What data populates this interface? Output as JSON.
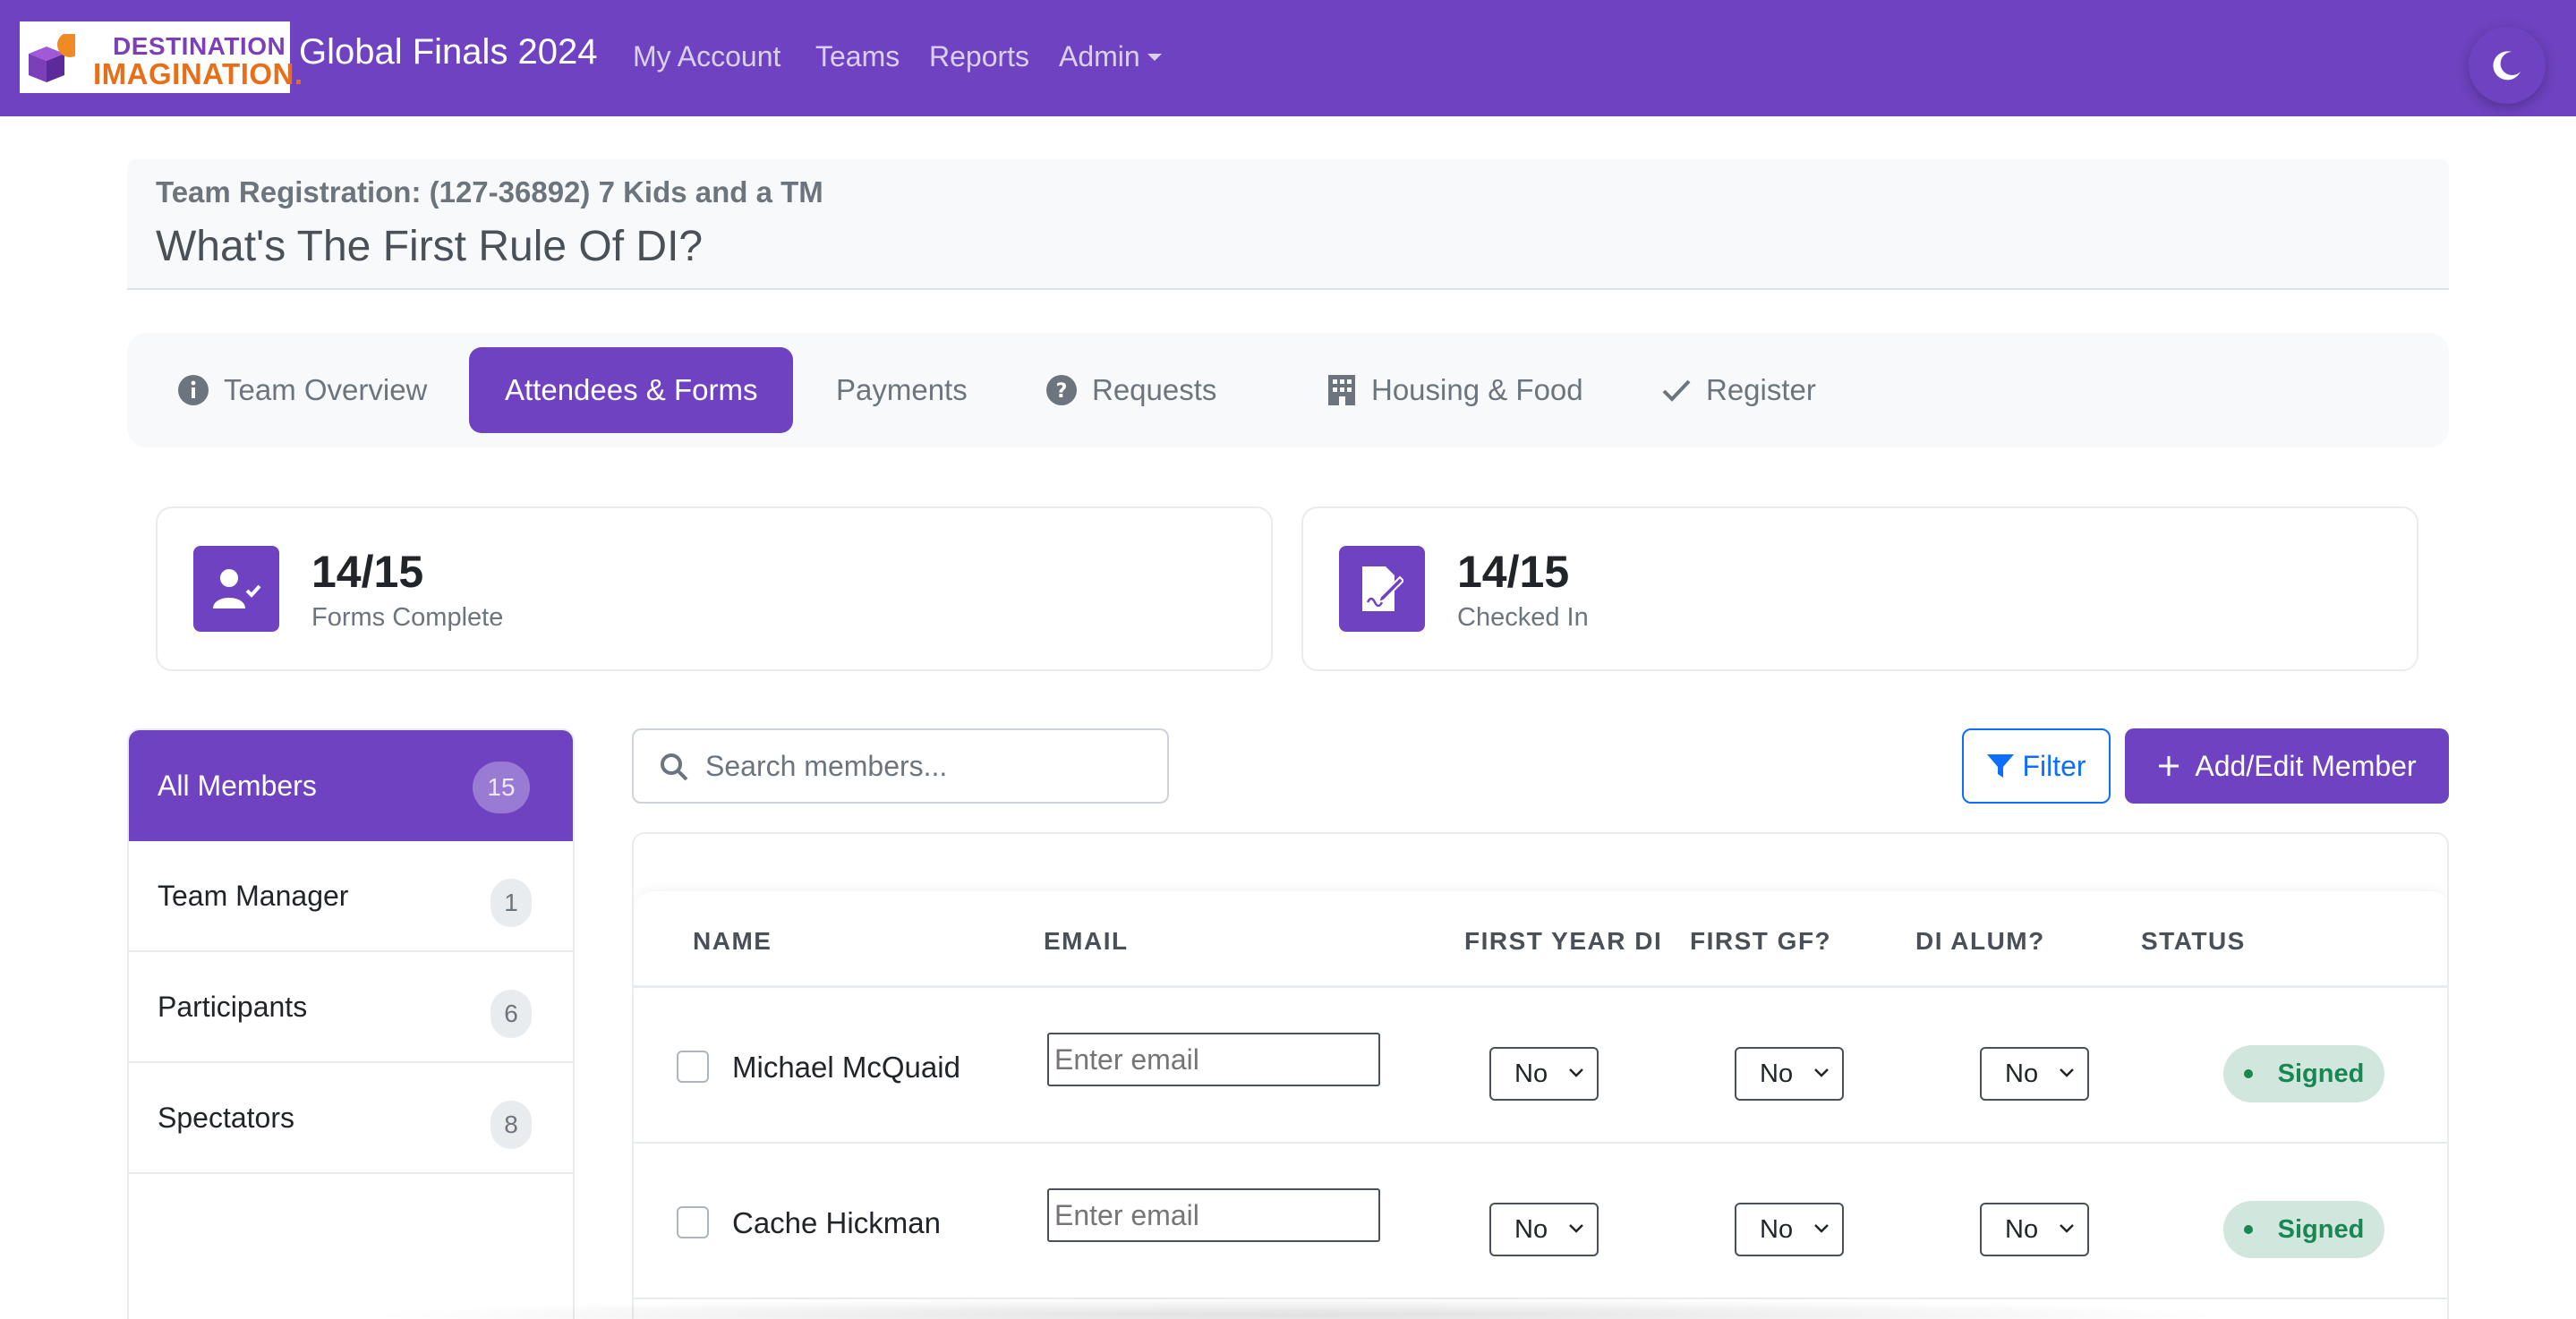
{
  "navbar": {
    "logo_word1": "DESTINATION",
    "logo_word2": "IMAGINATION.",
    "brand": "Global Finals 2024",
    "links": [
      "My Account",
      "Teams",
      "Reports",
      "Admin"
    ],
    "theme_icon": "moon-icon"
  },
  "header": {
    "subtitle": "Team Registration: (127-36892) 7 Kids and a TM",
    "title": "What's The First Rule Of DI?"
  },
  "tabs": [
    {
      "label": "Team Overview",
      "icon": "info-icon"
    },
    {
      "label": "Attendees & Forms",
      "icon": ""
    },
    {
      "label": "Payments",
      "icon": ""
    },
    {
      "label": "Requests",
      "icon": "question-icon"
    },
    {
      "label": "Housing & Food",
      "icon": "building-icon"
    },
    {
      "label": "Register",
      "icon": "check-icon"
    }
  ],
  "active_tab": "Attendees & Forms",
  "stats": [
    {
      "value": "14/15",
      "label": "Forms Complete",
      "icon": "user-check-icon"
    },
    {
      "value": "14/15",
      "label": "Checked In",
      "icon": "file-signature-icon"
    }
  ],
  "sidebar": {
    "items": [
      {
        "label": "All Members",
        "count": "15"
      },
      {
        "label": "Team Manager",
        "count": "1"
      },
      {
        "label": "Participants",
        "count": "6"
      },
      {
        "label": "Spectators",
        "count": "8"
      }
    ]
  },
  "search": {
    "placeholder": "Search members..."
  },
  "toolbar": {
    "filter_label": "Filter",
    "add_label": "Add/Edit Member"
  },
  "table": {
    "headers": [
      "NAME",
      "EMAIL",
      "FIRST YEAR DI",
      "FIRST GF?",
      "DI ALUM?",
      "STATUS"
    ],
    "email_placeholder": "Enter email",
    "rows": [
      {
        "name": "Michael McQuaid",
        "first_year": "No",
        "first_gf": "No",
        "alum": "No",
        "status": "Signed"
      },
      {
        "name": "Cache Hickman",
        "first_year": "No",
        "first_gf": "No",
        "alum": "No",
        "status": "Signed"
      }
    ]
  },
  "colors": {
    "brand": "#6f42c1",
    "success": "#198754",
    "primary": "#0d6efd"
  }
}
